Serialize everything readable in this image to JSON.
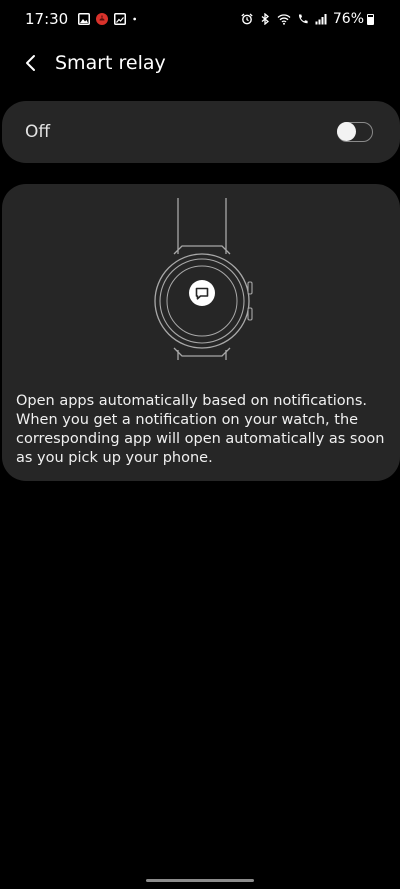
{
  "status_bar": {
    "time": "17:30",
    "battery_percent": "76%",
    "battery_level": 0.76,
    "left_icons": [
      "gallery-icon",
      "app-notification-icon",
      "screenshot-icon",
      "more-dot-icon"
    ],
    "right_icons": [
      "alarm-icon",
      "bluetooth-icon",
      "wifi-icon",
      "volte-call-icon",
      "signal-icon",
      "battery-icon"
    ]
  },
  "header": {
    "title": "Smart relay",
    "back_icon": "chevron-left-icon"
  },
  "master_switch": {
    "label": "Off",
    "enabled": false
  },
  "info": {
    "illustration_icon": "chat-bubble-icon",
    "description": "Open apps automatically based on notifications. When you get a notification on your watch, the corresponding app will open automatically as soon as you pick up your phone."
  },
  "colors": {
    "background": "#000000",
    "card": "#262626",
    "text": "#ffffff",
    "notification_badge": "#d9322b"
  }
}
